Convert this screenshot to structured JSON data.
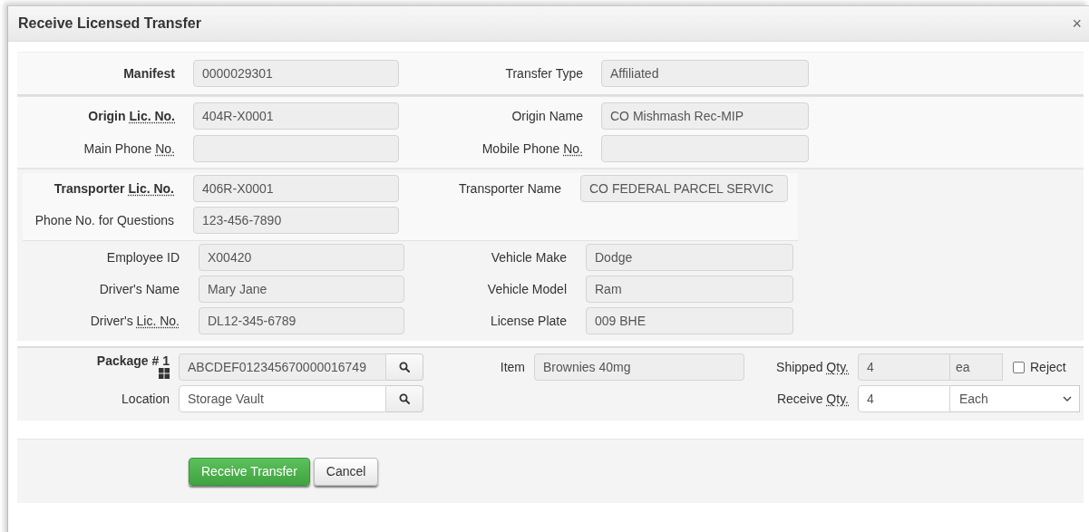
{
  "dialog": {
    "title": "Receive Licensed Transfer",
    "close": "×"
  },
  "sections": [
    {
      "rows": [
        [
          {
            "label": [
              {
                "text": "Manifest",
                "abbr": false
              }
            ],
            "bold": true,
            "value": "0000029301"
          },
          {
            "label": [
              {
                "text": "Transfer Type",
                "abbr": false
              }
            ],
            "bold": false,
            "value": "Affiliated"
          }
        ]
      ]
    },
    {
      "rows": [
        [
          {
            "label": [
              {
                "text": "Origin ",
                "abbr": false
              },
              {
                "text": "Lic. No.",
                "abbr": true
              }
            ],
            "bold": true,
            "value": "404R-X0001"
          },
          {
            "label": [
              {
                "text": "Origin Name",
                "abbr": false
              }
            ],
            "bold": false,
            "value": "CO Mishmash Rec-MIP"
          }
        ],
        [
          {
            "label": [
              {
                "text": "Main Phone ",
                "abbr": false
              },
              {
                "text": "No.",
                "abbr": true
              }
            ],
            "bold": false
          },
          {
            "label": [
              {
                "text": "Mobile Phone ",
                "abbr": false
              },
              {
                "text": "No.",
                "abbr": true
              }
            ],
            "bold": false
          }
        ]
      ]
    },
    {
      "rows": [
        [
          {
            "label": [
              {
                "text": "Transporter ",
                "abbr": false
              },
              {
                "text": "Lic. No.",
                "abbr": true
              }
            ],
            "bold": true,
            "value": "406R-X0001"
          },
          {
            "label": [
              {
                "text": "Transporter Name",
                "abbr": false
              }
            ],
            "bold": false,
            "value": "CO FEDERAL PARCEL SERVIC"
          }
        ],
        [
          {
            "label": [
              {
                "text": "Phone No. for Questions",
                "abbr": false
              }
            ],
            "bold": false,
            "value": "123-456-7890"
          }
        ]
      ]
    },
    {
      "rows": [
        [
          {
            "label": [
              {
                "text": "Employee ID",
                "abbr": false
              }
            ],
            "bold": false,
            "value": "X00420"
          },
          {
            "label": [
              {
                "text": "Vehicle Make",
                "abbr": false
              }
            ],
            "bold": false,
            "value": "Dodge"
          }
        ],
        [
          {
            "label": [
              {
                "text": "Driver's Name",
                "abbr": false
              }
            ],
            "bold": false,
            "value": "Mary Jane"
          },
          {
            "label": [
              {
                "text": "Vehicle Model",
                "abbr": false
              }
            ],
            "bold": false,
            "value": "Ram"
          }
        ],
        [
          {
            "label": [
              {
                "text": "Driver's ",
                "abbr": false
              },
              {
                "text": "Lic. No.",
                "abbr": true
              }
            ],
            "bold": false,
            "value": "DL12-345-6789"
          },
          {
            "label": [
              {
                "text": "License Plate",
                "abbr": false
              }
            ],
            "bold": false,
            "value": "009 BHE"
          }
        ]
      ]
    }
  ],
  "package": {
    "label": "Package # 1",
    "id": "ABCDEF012345670000016749",
    "location_label": "Location",
    "location": "Storage Vault",
    "item_label": "Item",
    "item": "Brownies 40mg",
    "shipped_qty_label": [
      {
        "text": "Shipped ",
        "abbr": false
      },
      {
        "text": "Qty.",
        "abbr": true
      }
    ],
    "shipped_qty": "4",
    "shipped_unit": "ea",
    "reject": {
      "label": "Reject",
      "checked": false
    },
    "receive_qty_label": [
      {
        "text": "Receive ",
        "abbr": false
      },
      {
        "text": "Qty.",
        "abbr": true
      }
    ],
    "receive_qty": "4",
    "receive_unit": "Each"
  },
  "buttons": [
    {
      "label": "Receive Transfer",
      "kind": "primary"
    },
    {
      "label": "Cancel",
      "kind": "default"
    }
  ]
}
